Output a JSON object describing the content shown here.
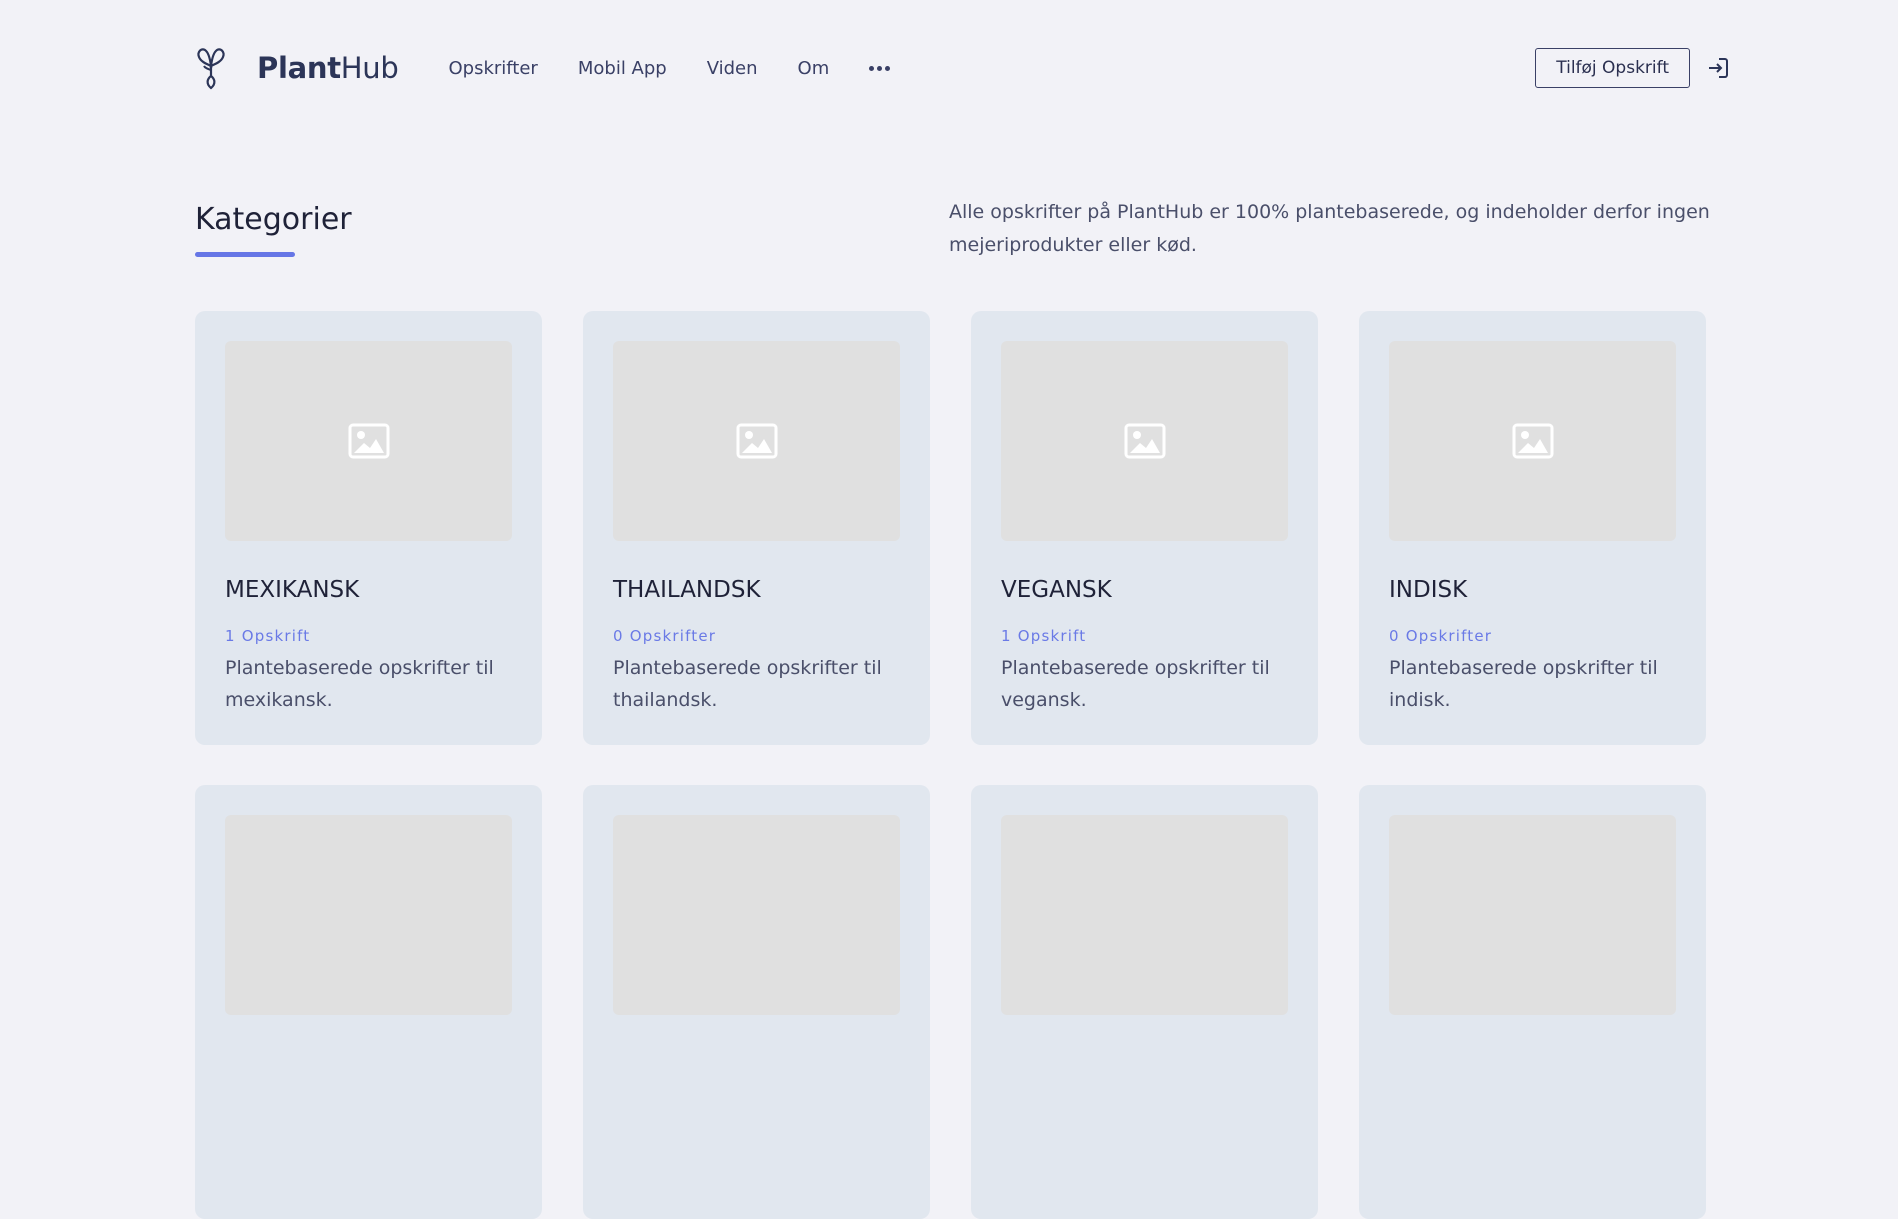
{
  "brand": {
    "bold": "Plant",
    "light": "Hub"
  },
  "nav": [
    "Opskrifter",
    "Mobil App",
    "Viden",
    "Om"
  ],
  "header": {
    "add_button": "Tilføj Opskrift",
    "more_icon": "ellipsis-icon",
    "login_icon": "login-icon"
  },
  "page": {
    "title": "Kategorier",
    "intro": "Alle opskrifter på PlantHub er 100% plantebaserede, og indeholder derfor ingen mejeriprodukter eller kød."
  },
  "categories": [
    {
      "name": "MEXIKANSK",
      "count": "1 Opskrift",
      "description": "Plantebaserede opskrifter til mexikansk."
    },
    {
      "name": "THAILANDSK",
      "count": "0 Opskrifter",
      "description": "Plantebaserede opskrifter til thailandsk."
    },
    {
      "name": "VEGANSK",
      "count": "1 Opskrift",
      "description": "Plantebaserede opskrifter til vegansk."
    },
    {
      "name": "INDISK",
      "count": "0 Opskrifter",
      "description": "Plantebaserede opskrifter til indisk."
    },
    {
      "name": "",
      "count": "",
      "description": ""
    },
    {
      "name": "",
      "count": "",
      "description": ""
    },
    {
      "name": "",
      "count": "",
      "description": ""
    },
    {
      "name": "",
      "count": "",
      "description": ""
    }
  ],
  "colors": {
    "accent": "#6676e6",
    "background": "#f2f2f7",
    "card": "#e1e7ef",
    "placeholder": "#e0e0e0"
  }
}
